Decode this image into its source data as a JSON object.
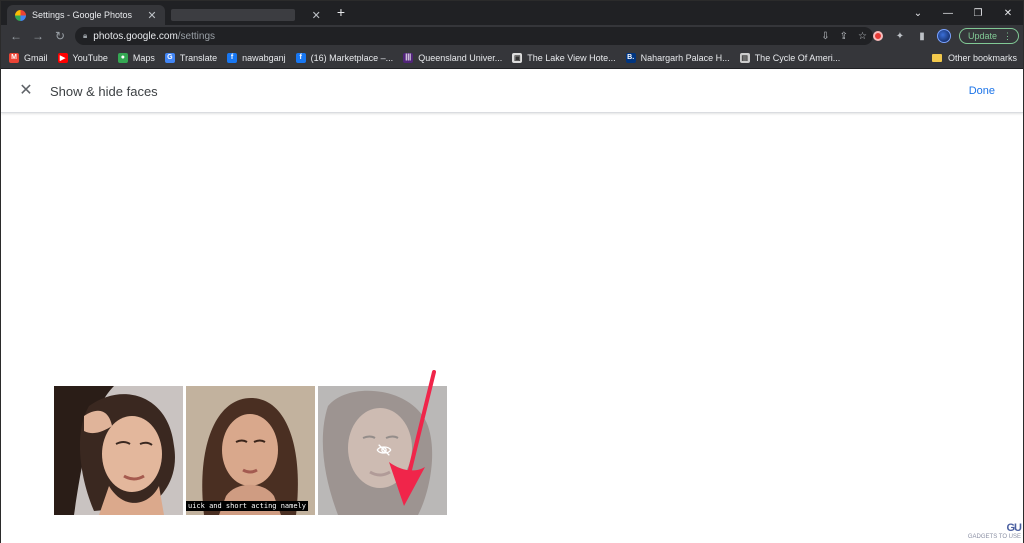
{
  "browser": {
    "tabs": [
      {
        "title": "Settings - Google Photos",
        "close": "✕"
      },
      {
        "title": "",
        "close": "✕"
      }
    ],
    "new_tab": "+",
    "url_host": "photos.google.com",
    "url_path": "/settings",
    "update_label": "Update",
    "bookmarks": [
      {
        "label": "Gmail",
        "icon": "gmail-icon",
        "color": "#ea4335"
      },
      {
        "label": "YouTube",
        "icon": "youtube-icon",
        "color": "#ff0000"
      },
      {
        "label": "Maps",
        "icon": "maps-icon",
        "color": "#34a853"
      },
      {
        "label": "Translate",
        "icon": "translate-icon",
        "color": "#4285f4"
      },
      {
        "label": "nawabganj",
        "icon": "facebook-icon",
        "color": "#1877f2"
      },
      {
        "label": "(16) Marketplace –...",
        "icon": "facebook-icon",
        "color": "#1877f2"
      },
      {
        "label": "Queensland Univer...",
        "icon": "queensland-icon",
        "color": "#51247a"
      },
      {
        "label": "The Lake View Hote...",
        "icon": "hotel-icon",
        "color": "#dddddd"
      },
      {
        "label": "Nahargarh Palace H...",
        "icon": "booking-icon",
        "color": "#003580"
      },
      {
        "label": "The Cycle Of Ameri...",
        "icon": "doc-icon",
        "color": "#cccccc"
      }
    ],
    "other_bookmarks": "Other bookmarks"
  },
  "app": {
    "title": "Show & hide faces",
    "done_label": "Done"
  },
  "faces": [
    {
      "state": "visible",
      "caption": ""
    },
    {
      "state": "visible",
      "caption": "uick and short acting namely"
    },
    {
      "state": "hidden",
      "caption": ""
    }
  ],
  "watermark": {
    "logo": "GU",
    "text": "GADGETS TO USE"
  },
  "colors": {
    "accent": "#1a73e8",
    "arrow": "#f0254a",
    "chrome_dark": "#202124",
    "chrome_toolbar": "#35363a"
  }
}
